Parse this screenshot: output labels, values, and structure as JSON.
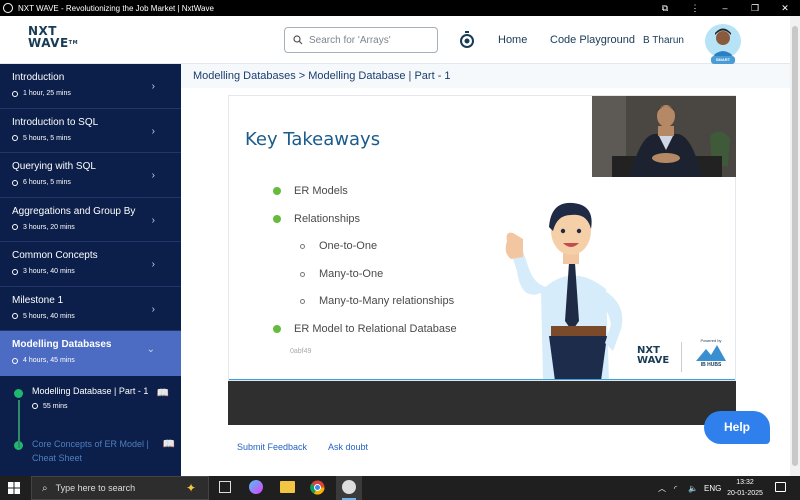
{
  "window": {
    "title": "NXT WAVE - Revolutionizing the Job Market | NxtWave"
  },
  "header": {
    "logo_line1": "NXT",
    "logo_line2": "WAVE",
    "logo_tm": "TM",
    "search_placeholder": "Search for 'Arrays'",
    "nav_home": "Home",
    "nav_code": "Code Playground",
    "user_name": "B Tharun",
    "avatar_badge": "SMART"
  },
  "sidebar": {
    "items": [
      {
        "title": "Introduction",
        "duration": "1 hour, 25 mins"
      },
      {
        "title": "Introduction to SQL",
        "duration": "5 hours, 5 mins"
      },
      {
        "title": "Querying with SQL",
        "duration": "6 hours, 5 mins"
      },
      {
        "title": "Aggregations and Group By",
        "duration": "3 hours, 20 mins"
      },
      {
        "title": "Common Concepts",
        "duration": "3 hours, 40 mins"
      },
      {
        "title": "Milestone 1",
        "duration": "5 hours, 40 mins"
      },
      {
        "title": "Modelling Databases",
        "duration": "4 hours, 45 mins"
      }
    ],
    "sub_items": [
      {
        "title": "Modelling Database | Part - 1",
        "duration": "55 mins"
      },
      {
        "title": "Core Concepts of ER Model | Cheat Sheet"
      }
    ]
  },
  "main": {
    "breadcrumb": "Modelling Databases > Modelling Database | Part - 1",
    "slide": {
      "title": "Key Takeaways",
      "bullets": [
        {
          "text": "ER Models",
          "level": 1
        },
        {
          "text": "Relationships",
          "level": 1
        },
        {
          "text": "One-to-One",
          "level": 2
        },
        {
          "text": "Many-to-One",
          "level": 2
        },
        {
          "text": "Many-to-Many relationships",
          "level": 2
        },
        {
          "text": "ER Model to Relational Database",
          "level": 1
        }
      ],
      "code": "0abf49",
      "brand_nxt": "NXT",
      "brand_wave": "WAVE",
      "brand_powered": "Powered by",
      "brand_ib": "IB HUBS"
    },
    "submit_feedback": "Submit Feedback",
    "ask_doubt": "Ask doubt",
    "help": "Help"
  },
  "taskbar": {
    "search_placeholder": "Type here to search",
    "lang": "ENG",
    "time": "13:32",
    "date": "20-01-2025"
  },
  "colors": {
    "sidebar_bg": "#0c1f4a",
    "sidebar_active": "#4c6bc2",
    "accent_blue": "#2f80ed",
    "check_green": "#66bb3c",
    "slide_title": "#1a5b8c"
  }
}
